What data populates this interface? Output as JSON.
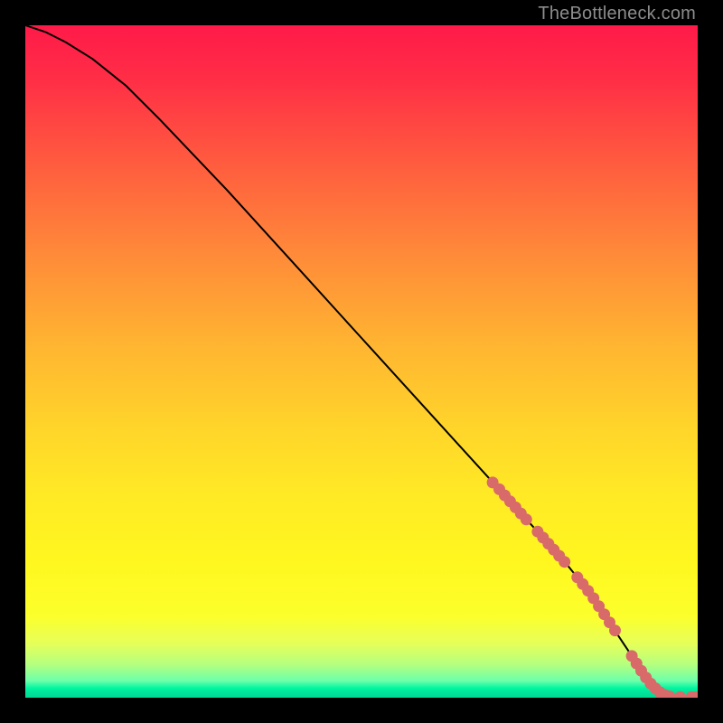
{
  "footer_text": "TheBottleneck.com",
  "colors": {
    "background": "#000000",
    "curve": "#000000",
    "marker_fill": "#d86a6a",
    "marker_stroke": "#bb4e4e",
    "footer": "#8c8c8c"
  },
  "chart_data": {
    "type": "line",
    "title": "",
    "xlabel": "",
    "ylabel": "",
    "xlim": [
      0,
      100
    ],
    "ylim": [
      0,
      100
    ],
    "series": [
      {
        "name": "curve",
        "x": [
          0,
          3,
          6,
          10,
          15,
          20,
          30,
          40,
          50,
          60,
          70,
          75,
          80,
          84,
          86,
          88,
          90,
          92,
          94,
          96,
          98,
          100
        ],
        "y": [
          100,
          99,
          97.5,
          95,
          91,
          86,
          75.5,
          64.5,
          53.5,
          42.5,
          31.5,
          26,
          20.5,
          15.5,
          12.5,
          9.5,
          6.5,
          3.5,
          1.2,
          0.3,
          0.1,
          0.1
        ]
      }
    ],
    "markers": [
      {
        "x": 69.5,
        "y": 32.0
      },
      {
        "x": 70.5,
        "y": 31.0
      },
      {
        "x": 71.3,
        "y": 30.1
      },
      {
        "x": 72.1,
        "y": 29.2
      },
      {
        "x": 72.9,
        "y": 28.3
      },
      {
        "x": 73.7,
        "y": 27.4
      },
      {
        "x": 74.5,
        "y": 26.5
      },
      {
        "x": 76.2,
        "y": 24.7
      },
      {
        "x": 77.0,
        "y": 23.8
      },
      {
        "x": 77.8,
        "y": 22.9
      },
      {
        "x": 78.6,
        "y": 22.0
      },
      {
        "x": 79.4,
        "y": 21.1
      },
      {
        "x": 80.2,
        "y": 20.2
      },
      {
        "x": 82.1,
        "y": 17.9
      },
      {
        "x": 82.9,
        "y": 16.9
      },
      {
        "x": 83.7,
        "y": 15.9
      },
      {
        "x": 84.5,
        "y": 14.8
      },
      {
        "x": 85.3,
        "y": 13.6
      },
      {
        "x": 86.1,
        "y": 12.4
      },
      {
        "x": 86.9,
        "y": 11.2
      },
      {
        "x": 87.7,
        "y": 10.0
      },
      {
        "x": 90.2,
        "y": 6.2
      },
      {
        "x": 90.9,
        "y": 5.1
      },
      {
        "x": 91.6,
        "y": 4.0
      },
      {
        "x": 92.3,
        "y": 3.0
      },
      {
        "x": 93.0,
        "y": 2.1
      },
      {
        "x": 93.7,
        "y": 1.4
      },
      {
        "x": 94.4,
        "y": 0.8
      },
      {
        "x": 95.1,
        "y": 0.4
      },
      {
        "x": 95.8,
        "y": 0.2
      },
      {
        "x": 97.4,
        "y": 0.1
      },
      {
        "x": 99.1,
        "y": 0.1
      },
      {
        "x": 99.8,
        "y": 0.1
      }
    ]
  }
}
